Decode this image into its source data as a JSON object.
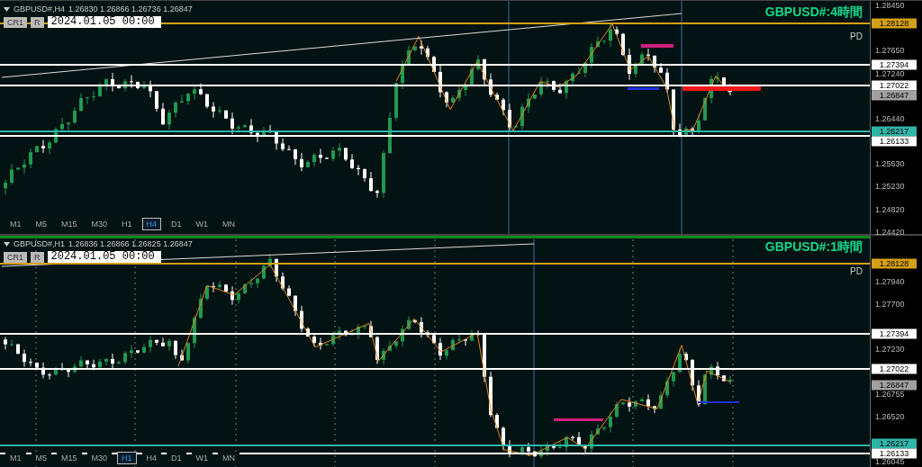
{
  "panes": [
    {
      "active": false,
      "symbol": "GBPUSD#,H4",
      "ohlc": "1.26830 1.26866 1.26736 1.26847",
      "buttons": [
        "CR1",
        "R"
      ],
      "date": "2024.01.05 00:00",
      "title": "GBPUSD#:4時間",
      "tag": "PD",
      "price_ticks": [
        "1.28450",
        "1.27650",
        "1.27240",
        "1.26440",
        "1.25630",
        "1.25230",
        "1.24820",
        "1.24420"
      ],
      "price_tags": [
        {
          "text": "1.28128",
          "kind": "level",
          "color": "#d4a017"
        },
        {
          "text": "1.27394",
          "kind": "level",
          "color": "#ffffff"
        },
        {
          "text": "1.27022",
          "kind": "level",
          "color": "#ffffff"
        },
        {
          "text": "1.26847",
          "kind": "bid",
          "color": "#a0a0a0"
        },
        {
          "text": "1.26217",
          "kind": "level",
          "color": "#2fb5a8"
        },
        {
          "text": "1.26133",
          "kind": "level",
          "color": "#ffffff"
        }
      ],
      "timeframes": [
        {
          "label": "M1",
          "selected": false
        },
        {
          "label": "M5",
          "selected": false
        },
        {
          "label": "M15",
          "selected": false
        },
        {
          "label": "M30",
          "selected": false
        },
        {
          "label": "H1",
          "selected": false
        },
        {
          "label": "H4",
          "selected": true
        },
        {
          "label": "D1",
          "selected": false
        },
        {
          "label": "W1",
          "selected": false
        },
        {
          "label": "MN",
          "selected": false
        }
      ]
    },
    {
      "active": true,
      "symbol": "GBPUSD#,H1",
      "ohlc": "1.26836 1.26866 1.26825 1.26847",
      "buttons": [
        "CR1",
        "R"
      ],
      "date": "2024.01.05 00:00",
      "title": "GBPUSD#:1時間",
      "tag": "PD",
      "price_ticks": [
        "1.27940",
        "1.27700",
        "1.27230",
        "1.26755",
        "1.26520",
        "1.26045"
      ],
      "price_tags": [
        {
          "text": "1.28128",
          "kind": "level",
          "color": "#d4a017"
        },
        {
          "text": "1.27394",
          "kind": "level",
          "color": "#ffffff"
        },
        {
          "text": "1.27022",
          "kind": "level",
          "color": "#ffffff"
        },
        {
          "text": "1.26847",
          "kind": "bid",
          "color": "#a0a0a0"
        },
        {
          "text": "1.26217",
          "kind": "level",
          "color": "#2fb5a8"
        },
        {
          "text": "1.26133",
          "kind": "level",
          "color": "#ffffff"
        }
      ],
      "timeframes": [
        {
          "label": "M1",
          "selected": false
        },
        {
          "label": "M5",
          "selected": false
        },
        {
          "label": "M15",
          "selected": false
        },
        {
          "label": "M30",
          "selected": false
        },
        {
          "label": "H1",
          "selected": true
        },
        {
          "label": "H4",
          "selected": false
        },
        {
          "label": "D1",
          "selected": false
        },
        {
          "label": "W1",
          "selected": false
        },
        {
          "label": "MN",
          "selected": false
        }
      ]
    }
  ]
}
